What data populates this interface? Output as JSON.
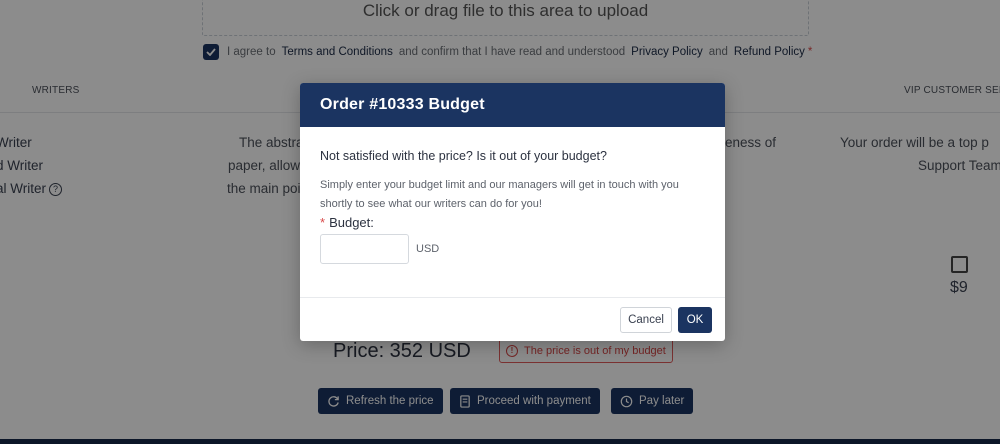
{
  "upload": {
    "text": "Click or drag file to this area to upload"
  },
  "agreement": {
    "prefix": "I agree to",
    "terms": "Terms and Conditions",
    "middle": "and confirm that I have read and understood",
    "privacy": "Privacy Policy",
    "and": "and",
    "refund": "Refund Policy",
    "required_mark": "*",
    "checked": true
  },
  "columns": {
    "writers": "WRITERS",
    "vip": "VIP CUSTOMER SERVICE"
  },
  "writer_options": [
    "Writer",
    "d Writer",
    "al Writer"
  ],
  "help_glyph": "?",
  "description_lines": [
    "The abstra",
    "paper, allow",
    "the main poi"
  ],
  "description_right_fragment": "eness of",
  "vip": {
    "lines": [
      "Your order will be a top p",
      "Support Team"
    ],
    "price": "$9",
    "checked": false
  },
  "price": {
    "label": "Price: 352 USD",
    "budget_link": "The price is out of my budget",
    "budget_icon": "!"
  },
  "actions": [
    {
      "label": "Refresh the price",
      "icon": "refresh-icon"
    },
    {
      "label": "Proceed with payment",
      "icon": "receipt-icon"
    },
    {
      "label": "Pay later",
      "icon": "clock-icon"
    }
  ],
  "modal": {
    "title": "Order #10333 Budget",
    "heading": "Not satisfied with the price? Is it out of your budget?",
    "description": "Simply enter your budget limit and our managers will get in touch with you shortly to see what our writers can do for you!",
    "budget_label": "Budget:",
    "required_mark": "*",
    "budget_value": "",
    "budget_placeholder": "",
    "currency": "USD",
    "cancel_label": "Cancel",
    "ok_label": "OK"
  },
  "colors": {
    "primary": "#1b3461",
    "danger": "#d84a4a",
    "overlay": "rgba(0,0,0,0.45)"
  }
}
